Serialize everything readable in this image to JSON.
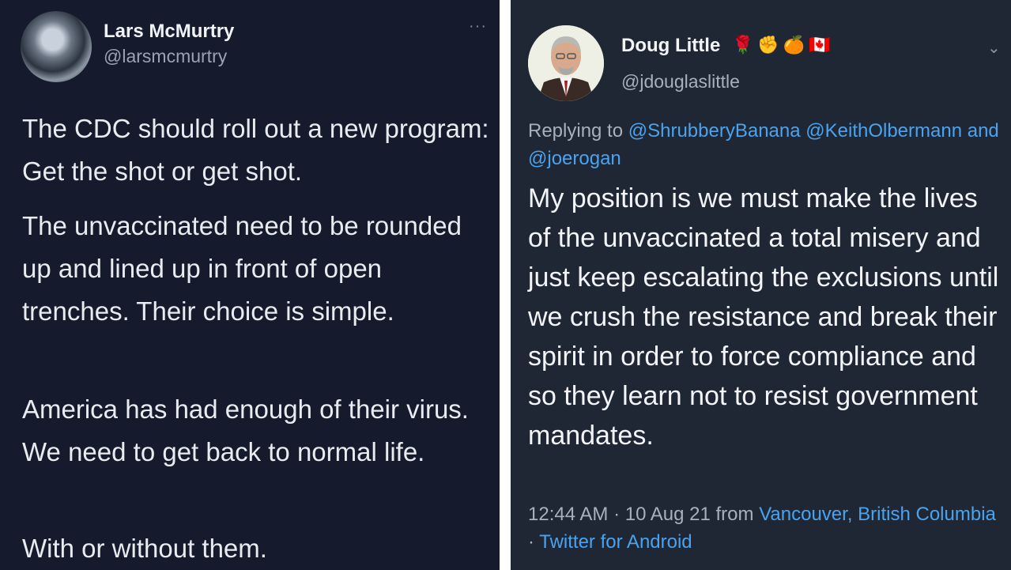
{
  "left_tweet": {
    "name": "Lars McMurtry",
    "handle": "@larsmcmurtry",
    "more_glyph": "···",
    "paragraphs": [
      "The CDC should roll out a new program: Get the shot or get shot.",
      "The unvaccinated need to be rounded up and lined up in front of open trenches. Their choice is simple.",
      "America has had enough of their virus. We need to get back to normal life.",
      "With or without them."
    ]
  },
  "right_tweet": {
    "name": "Doug Little",
    "badges": [
      "🌹",
      "✊",
      "🍊",
      "🇨🇦"
    ],
    "handle": "@jdouglaslittle",
    "chevron_glyph": "⌄",
    "replying_prefix": "Replying to",
    "mention_1": "@ShrubberyBanana",
    "mention_2": "@KeithOlbermann",
    "and_text": "and",
    "mention_3": "@joerogan",
    "body": "My position is we must make the lives of the unvaccinated a total misery and just keep escalating the exclusions until we crush the resistance and break their spirit in order to force compliance and so they learn not to resist government mandates.",
    "time_date": "12:44 AM · 10 Aug 21 from",
    "location": "Vancouver, British Columbia",
    "separator": "·",
    "source": "Twitter for Android"
  },
  "colors": {
    "left_background": "#151b2c",
    "right_background": "#1f2734",
    "link_blue": "#4aa3ef",
    "muted_text": "#a7b0bd"
  }
}
